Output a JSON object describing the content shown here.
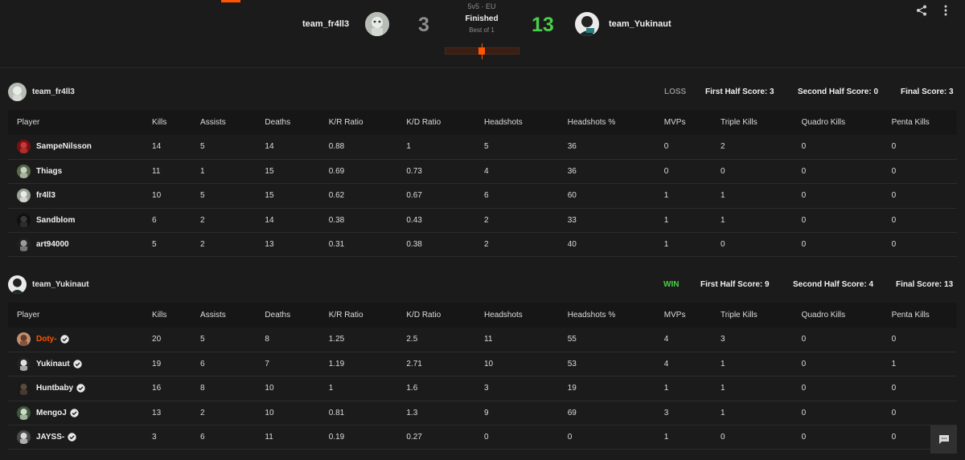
{
  "match": {
    "mode": "5v5 · EU",
    "status": "Finished",
    "best_of": "Best of 1",
    "team1": {
      "name": "team_fr4ll3",
      "score": "3"
    },
    "team2": {
      "name": "team_Yukinaut",
      "score": "13"
    },
    "progress_fraction": 0.48,
    "colors": {
      "accent": "#ff5500",
      "win": "#4ccd4c",
      "loss": "#8d8d8d"
    }
  },
  "icons": {
    "share": "share-icon",
    "menu": "more-vertical-icon",
    "chat": "chat-icon",
    "verified": "verified-badge-icon"
  },
  "columns": [
    "Player",
    "Kills",
    "Assists",
    "Deaths",
    "K/R Ratio",
    "K/D Ratio",
    "Headshots",
    "Headshots %",
    "MVPs",
    "Triple Kills",
    "Quadro Kills",
    "Penta Kills"
  ],
  "teams": [
    {
      "name": "team_fr4ll3",
      "result": "LOSS",
      "first_half": "First Half Score: 3",
      "second_half": "Second Half Score: 0",
      "final": "Final Score: 3",
      "players": [
        {
          "name": "SampeNilsson",
          "verified": false,
          "highlight": false,
          "stats": [
            "14",
            "5",
            "14",
            "0.88",
            "1",
            "5",
            "36",
            "0",
            "2",
            "0",
            "0"
          ]
        },
        {
          "name": "Thiags",
          "verified": false,
          "highlight": false,
          "stats": [
            "11",
            "1",
            "15",
            "0.69",
            "0.73",
            "4",
            "36",
            "0",
            "0",
            "0",
            "0"
          ]
        },
        {
          "name": "fr4ll3",
          "verified": false,
          "highlight": false,
          "stats": [
            "10",
            "5",
            "15",
            "0.62",
            "0.67",
            "6",
            "60",
            "1",
            "1",
            "0",
            "0"
          ]
        },
        {
          "name": "Sandblom",
          "verified": false,
          "highlight": false,
          "stats": [
            "6",
            "2",
            "14",
            "0.38",
            "0.43",
            "2",
            "33",
            "1",
            "1",
            "0",
            "0"
          ]
        },
        {
          "name": "art94000",
          "verified": false,
          "highlight": false,
          "stats": [
            "5",
            "2",
            "13",
            "0.31",
            "0.38",
            "2",
            "40",
            "1",
            "0",
            "0",
            "0"
          ]
        }
      ]
    },
    {
      "name": "team_Yukinaut",
      "result": "WIN",
      "first_half": "First Half Score: 9",
      "second_half": "Second Half Score: 4",
      "final": "Final Score: 13",
      "players": [
        {
          "name": "Doty-",
          "verified": true,
          "highlight": true,
          "stats": [
            "20",
            "5",
            "8",
            "1.25",
            "2.5",
            "11",
            "55",
            "4",
            "3",
            "0",
            "0"
          ]
        },
        {
          "name": "Yukinaut",
          "verified": true,
          "highlight": false,
          "stats": [
            "19",
            "6",
            "7",
            "1.19",
            "2.71",
            "10",
            "53",
            "4",
            "1",
            "0",
            "1"
          ]
        },
        {
          "name": "Huntbaby",
          "verified": true,
          "highlight": false,
          "stats": [
            "16",
            "8",
            "10",
            "1",
            "1.6",
            "3",
            "19",
            "1",
            "1",
            "0",
            "0"
          ]
        },
        {
          "name": "MengoJ",
          "verified": true,
          "highlight": false,
          "stats": [
            "13",
            "2",
            "10",
            "0.81",
            "1.3",
            "9",
            "69",
            "3",
            "1",
            "0",
            "0"
          ]
        },
        {
          "name": "JAYSS-",
          "verified": true,
          "highlight": false,
          "stats": [
            "3",
            "6",
            "11",
            "0.19",
            "0.27",
            "0",
            "0",
            "1",
            "0",
            "0",
            "0"
          ]
        }
      ]
    }
  ]
}
